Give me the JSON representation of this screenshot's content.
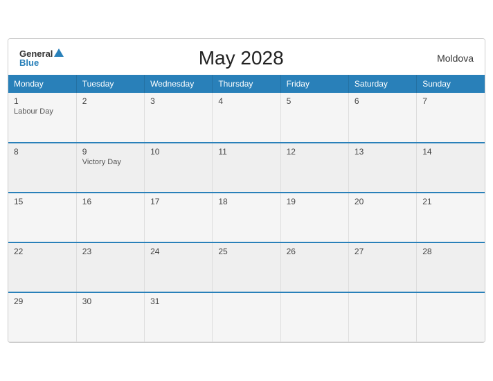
{
  "header": {
    "title": "May 2028",
    "country": "Moldova",
    "logo": {
      "general": "General",
      "blue": "Blue"
    }
  },
  "weekdays": [
    "Monday",
    "Tuesday",
    "Wednesday",
    "Thursday",
    "Friday",
    "Saturday",
    "Sunday"
  ],
  "weeks": [
    [
      {
        "day": "1",
        "holiday": "Labour Day"
      },
      {
        "day": "2",
        "holiday": ""
      },
      {
        "day": "3",
        "holiday": ""
      },
      {
        "day": "4",
        "holiday": ""
      },
      {
        "day": "5",
        "holiday": ""
      },
      {
        "day": "6",
        "holiday": ""
      },
      {
        "day": "7",
        "holiday": ""
      }
    ],
    [
      {
        "day": "8",
        "holiday": ""
      },
      {
        "day": "9",
        "holiday": "Victory Day"
      },
      {
        "day": "10",
        "holiday": ""
      },
      {
        "day": "11",
        "holiday": ""
      },
      {
        "day": "12",
        "holiday": ""
      },
      {
        "day": "13",
        "holiday": ""
      },
      {
        "day": "14",
        "holiday": ""
      }
    ],
    [
      {
        "day": "15",
        "holiday": ""
      },
      {
        "day": "16",
        "holiday": ""
      },
      {
        "day": "17",
        "holiday": ""
      },
      {
        "day": "18",
        "holiday": ""
      },
      {
        "day": "19",
        "holiday": ""
      },
      {
        "day": "20",
        "holiday": ""
      },
      {
        "day": "21",
        "holiday": ""
      }
    ],
    [
      {
        "day": "22",
        "holiday": ""
      },
      {
        "day": "23",
        "holiday": ""
      },
      {
        "day": "24",
        "holiday": ""
      },
      {
        "day": "25",
        "holiday": ""
      },
      {
        "day": "26",
        "holiday": ""
      },
      {
        "day": "27",
        "holiday": ""
      },
      {
        "day": "28",
        "holiday": ""
      }
    ],
    [
      {
        "day": "29",
        "holiday": ""
      },
      {
        "day": "30",
        "holiday": ""
      },
      {
        "day": "31",
        "holiday": ""
      },
      {
        "day": "",
        "holiday": ""
      },
      {
        "day": "",
        "holiday": ""
      },
      {
        "day": "",
        "holiday": ""
      },
      {
        "day": "",
        "holiday": ""
      }
    ]
  ]
}
